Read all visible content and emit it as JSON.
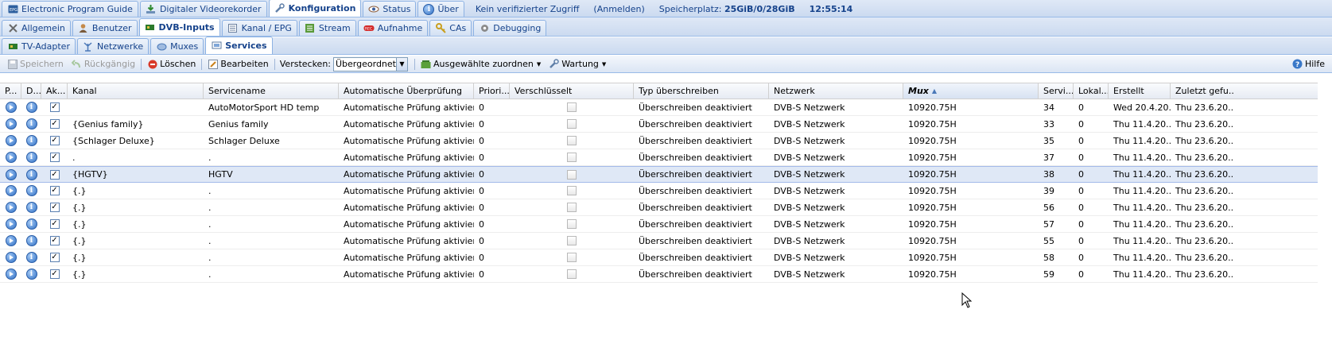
{
  "top_tabs": [
    {
      "label": "Electronic Program Guide",
      "icon": "epg-icon"
    },
    {
      "label": "Digitaler Videorekorder",
      "icon": "download-icon"
    },
    {
      "label": "Konfiguration",
      "icon": "wrench-icon",
      "active": true
    },
    {
      "label": "Status",
      "icon": "eye-icon"
    },
    {
      "label": "Über",
      "icon": "info-icon"
    }
  ],
  "status": {
    "access": "Kein verifizierter Zugriff",
    "login": "(Anmelden)",
    "storage_label": "Speicherplatz:",
    "storage_value": "25GiB/0/28GiB",
    "time": "12:55:14"
  },
  "config_tabs": [
    {
      "label": "Allgemein",
      "icon": "tools-icon"
    },
    {
      "label": "Benutzer",
      "icon": "user-icon"
    },
    {
      "label": "DVB-Inputs",
      "icon": "tv-card-icon",
      "active": true
    },
    {
      "label": "Kanal / EPG",
      "icon": "list-icon"
    },
    {
      "label": "Stream",
      "icon": "stream-icon"
    },
    {
      "label": "Aufnahme",
      "icon": "record-icon"
    },
    {
      "label": "CAs",
      "icon": "key-icon"
    },
    {
      "label": "Debugging",
      "icon": "gear-icon"
    }
  ],
  "dvb_tabs": [
    {
      "label": "TV-Adapter",
      "icon": "adapter-icon"
    },
    {
      "label": "Netzwerke",
      "icon": "antenna-icon"
    },
    {
      "label": "Muxes",
      "icon": "mux-icon"
    },
    {
      "label": "Services",
      "icon": "services-icon",
      "active": true
    }
  ],
  "toolbar": {
    "save": "Speichern",
    "undo": "Rückgängig",
    "delete": "Löschen",
    "edit": "Bearbeiten",
    "hide_label": "Verstecken:",
    "hide_value": "Übergeordnet d",
    "assign": "Ausgewählte zuordnen",
    "maintenance": "Wartung",
    "help": "Hilfe"
  },
  "columns": [
    "P...",
    "D...",
    "Ak...",
    "Kanal",
    "Servicename",
    "Automatische Überprüfung",
    "Priori...",
    "Verschlüsselt",
    "Typ überschreiben",
    "Netzwerk",
    "Mux",
    "Servi...",
    "Lokal...",
    "Erstellt",
    "Zuletzt gefu..."
  ],
  "sorted_column": "Mux",
  "rows": [
    {
      "kanal": "",
      "servicename": "AutoMotorSport HD temp",
      "auto": "Automatische Prüfung aktiviert",
      "prio": "0",
      "typ": "Überschreiben deaktiviert",
      "netzwerk": "DVB-S Netzwerk",
      "mux": "10920.75H",
      "sid": "34",
      "lokal": "0",
      "erstellt": "Wed 20.4.20...",
      "zuletzt": "Thu 23.6.20...",
      "enabled": true,
      "encrypted": false
    },
    {
      "kanal": "{Genius family}",
      "servicename": "Genius family",
      "auto": "Automatische Prüfung aktiviert",
      "prio": "0",
      "typ": "Überschreiben deaktiviert",
      "netzwerk": "DVB-S Netzwerk",
      "mux": "10920.75H",
      "sid": "33",
      "lokal": "0",
      "erstellt": "Thu 11.4.20...",
      "zuletzt": "Thu 23.6.20...",
      "enabled": true,
      "encrypted": false
    },
    {
      "kanal": "{Schlager Deluxe}",
      "servicename": "Schlager Deluxe",
      "auto": "Automatische Prüfung aktiviert",
      "prio": "0",
      "typ": "Überschreiben deaktiviert",
      "netzwerk": "DVB-S Netzwerk",
      "mux": "10920.75H",
      "sid": "35",
      "lokal": "0",
      "erstellt": "Thu 11.4.20...",
      "zuletzt": "Thu 23.6.20...",
      "enabled": true,
      "encrypted": false
    },
    {
      "kanal": ".",
      "servicename": ".",
      "auto": "Automatische Prüfung aktiviert",
      "prio": "0",
      "typ": "Überschreiben deaktiviert",
      "netzwerk": "DVB-S Netzwerk",
      "mux": "10920.75H",
      "sid": "37",
      "lokal": "0",
      "erstellt": "Thu 11.4.20...",
      "zuletzt": "Thu 23.6.20...",
      "enabled": true,
      "encrypted": false
    },
    {
      "kanal": "{HGTV}",
      "servicename": "HGTV",
      "auto": "Automatische Prüfung aktiviert",
      "prio": "0",
      "typ": "Überschreiben deaktiviert",
      "netzwerk": "DVB-S Netzwerk",
      "mux": "10920.75H",
      "sid": "38",
      "lokal": "0",
      "erstellt": "Thu 11.4.20...",
      "zuletzt": "Thu 23.6.20...",
      "enabled": true,
      "encrypted": false,
      "selected": true
    },
    {
      "kanal": "{.}",
      "servicename": ".",
      "auto": "Automatische Prüfung aktiviert",
      "prio": "0",
      "typ": "Überschreiben deaktiviert",
      "netzwerk": "DVB-S Netzwerk",
      "mux": "10920.75H",
      "sid": "39",
      "lokal": "0",
      "erstellt": "Thu 11.4.20...",
      "zuletzt": "Thu 23.6.20...",
      "enabled": true,
      "encrypted": false
    },
    {
      "kanal": "{.}",
      "servicename": ".",
      "auto": "Automatische Prüfung aktiviert",
      "prio": "0",
      "typ": "Überschreiben deaktiviert",
      "netzwerk": "DVB-S Netzwerk",
      "mux": "10920.75H",
      "sid": "56",
      "lokal": "0",
      "erstellt": "Thu 11.4.20...",
      "zuletzt": "Thu 23.6.20...",
      "enabled": true,
      "encrypted": false
    },
    {
      "kanal": "{.}",
      "servicename": ".",
      "auto": "Automatische Prüfung aktiviert",
      "prio": "0",
      "typ": "Überschreiben deaktiviert",
      "netzwerk": "DVB-S Netzwerk",
      "mux": "10920.75H",
      "sid": "57",
      "lokal": "0",
      "erstellt": "Thu 11.4.20...",
      "zuletzt": "Thu 23.6.20...",
      "enabled": true,
      "encrypted": false
    },
    {
      "kanal": "{.}",
      "servicename": ".",
      "auto": "Automatische Prüfung aktiviert",
      "prio": "0",
      "typ": "Überschreiben deaktiviert",
      "netzwerk": "DVB-S Netzwerk",
      "mux": "10920.75H",
      "sid": "55",
      "lokal": "0",
      "erstellt": "Thu 11.4.20...",
      "zuletzt": "Thu 23.6.20...",
      "enabled": true,
      "encrypted": false
    },
    {
      "kanal": "{.}",
      "servicename": ".",
      "auto": "Automatische Prüfung aktiviert",
      "prio": "0",
      "typ": "Überschreiben deaktiviert",
      "netzwerk": "DVB-S Netzwerk",
      "mux": "10920.75H",
      "sid": "58",
      "lokal": "0",
      "erstellt": "Thu 11.4.20...",
      "zuletzt": "Thu 23.6.20...",
      "enabled": true,
      "encrypted": false
    },
    {
      "kanal": "{.}",
      "servicename": ".",
      "auto": "Automatische Prüfung aktiviert",
      "prio": "0",
      "typ": "Überschreiben deaktiviert",
      "netzwerk": "DVB-S Netzwerk",
      "mux": "10920.75H",
      "sid": "59",
      "lokal": "0",
      "erstellt": "Thu 11.4.20...",
      "zuletzt": "Thu 23.6.20...",
      "enabled": true,
      "encrypted": false
    }
  ]
}
